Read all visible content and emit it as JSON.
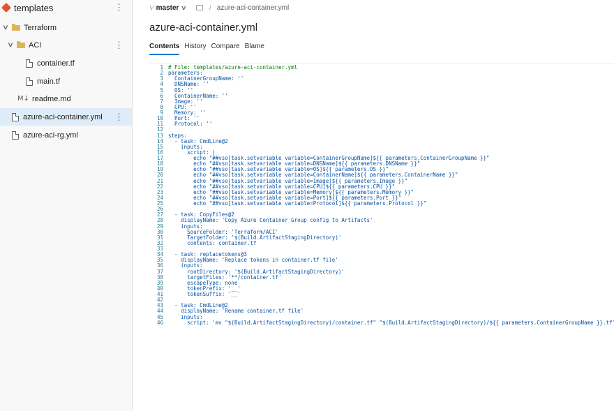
{
  "sidebar": {
    "repo_name": "templates",
    "items": [
      {
        "label": "Terraform",
        "kind": "folder",
        "expanded": true,
        "level": 0
      },
      {
        "label": "ACI",
        "kind": "folder",
        "expanded": true,
        "level": 1
      },
      {
        "label": "container.tf",
        "kind": "file",
        "level": 2
      },
      {
        "label": "main.tf",
        "kind": "file",
        "level": 2
      },
      {
        "label": "readme.md",
        "kind": "markdown",
        "level": 1
      },
      {
        "label": "azure-aci-container.yml",
        "kind": "file",
        "level": 0,
        "selected": true
      },
      {
        "label": "azure-aci-rg.yml",
        "kind": "file",
        "level": 0
      }
    ]
  },
  "branch": {
    "name": "master",
    "path_separator": "/",
    "path_file": "azure-aci-container.yml"
  },
  "file": {
    "title": "azure-aci-container.yml"
  },
  "tabs": [
    "Contents",
    "History",
    "Compare",
    "Blame"
  ],
  "code_lines": [
    "# File: templates/azure-aci-container.yml",
    "parameters:",
    "  ContainerGroupName: ''",
    "  DNSName: ''",
    "  OS: ''",
    "  ContainerName: ''",
    "  Image: ''",
    "  CPU: ''",
    "  Memory: ''",
    "  Port: ''",
    "  Protocol: ''",
    "",
    "steps:",
    "  - task: CmdLine@2",
    "    inputs:",
    "      script: |",
    "        echo \"##vso[task.setvariable variable=ContainerGroupName]${{ parameters.ContainerGroupName }}\"",
    "        echo \"##vso[task.setvariable variable=DNSName]${{ parameters.DNSName }}\"",
    "        echo \"##vso[task.setvariable variable=OS]${{ parameters.OS }}\"",
    "        echo \"##vso[task.setvariable variable=ContainerName]${{ parameters.ContainerName }}\"",
    "        echo \"##vso[task.setvariable variable=Image]${{ parameters.Image }}\"",
    "        echo \"##vso[task.setvariable variable=CPU]${{ parameters.CPU }}\"",
    "        echo \"##vso[task.setvariable variable=Memory]${{ parameters.Memory }}\"",
    "        echo \"##vso[task.setvariable variable=Port]${{ parameters.Port }}\"",
    "        echo \"##vso[task.setvariable variable=Protocol]${{ parameters.Protocol }}\"",
    "",
    "  - task: CopyFiles@2",
    "    displayName: 'Copy Azure Container Group config to Artifacts'",
    "    inputs:",
    "      SourceFolder: 'Terraform/ACI'",
    "      TargetFolder: '$(Build.ArtifactStagingDirectory)'",
    "      contents: container.tf",
    "",
    "  - task: replacetokens@3",
    "    displayName: 'Replace tokens in container.tf file'",
    "    inputs:",
    "      rootDirectory: '$(Build.ArtifactStagingDirectory)'",
    "      targetFiles: '**/container.tf'",
    "      escapeType: none",
    "      tokenPrefix: '__'",
    "      tokenSuffix: '__'",
    "",
    "  - task: CmdLine@2",
    "    displayName: 'Rename container.tf file'",
    "    inputs:",
    "      script: 'mv \"$(Build.ArtifactStagingDirectory)/container.tf\" \"$(Build.ArtifactStagingDirectory)/${{ parameters.ContainerGroupName }}.tf\"'"
  ],
  "colors": {
    "accent": "#0078d4",
    "selected_bg": "#deecf9",
    "line_number": "#237893",
    "code_text": "#0451a5",
    "comment": "#008000"
  }
}
